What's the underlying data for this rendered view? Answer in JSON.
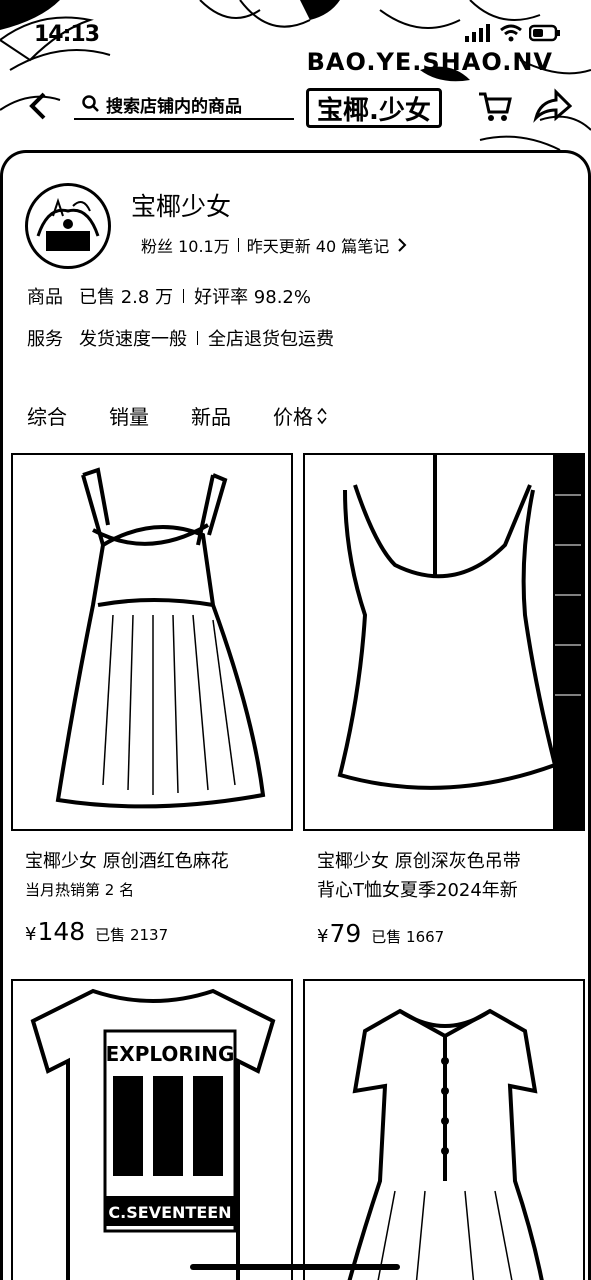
{
  "status_bar": {
    "time": "14:13"
  },
  "header": {
    "brand_title": "BAO.YE.SHAO.NV",
    "search_placeholder": "搜索店铺内的商品",
    "shop_logo_text": "宝椰.少女"
  },
  "shop": {
    "name": "宝椰少女",
    "followers": "粉丝 10.1万",
    "update_note": "昨天更新 40 篇笔记",
    "goods_label": "商品",
    "goods_sold": "已售 2.8 万",
    "goods_rating": "好评率 98.2%",
    "service_label": "服务",
    "service_speed": "发货速度一般",
    "service_return": "全店退货包运费"
  },
  "sort_tabs": [
    "综合",
    "销量",
    "新品",
    "价格"
  ],
  "products": [
    {
      "title": "宝椰少女 原创酒红色麻花",
      "subtitle": "当月热销第 2 名",
      "currency": "¥",
      "price": "148",
      "sold": "已售 2137"
    },
    {
      "title": "宝椰少女 原创深灰色吊带",
      "subtitle": "背心T恤女夏季2024年新",
      "currency": "¥",
      "price": "79",
      "sold": "已售 1667"
    },
    {
      "title": "",
      "graphic_text_1": "EXPLORING",
      "graphic_text_2": "C.SEVENTEEN"
    },
    {
      "title": ""
    }
  ]
}
